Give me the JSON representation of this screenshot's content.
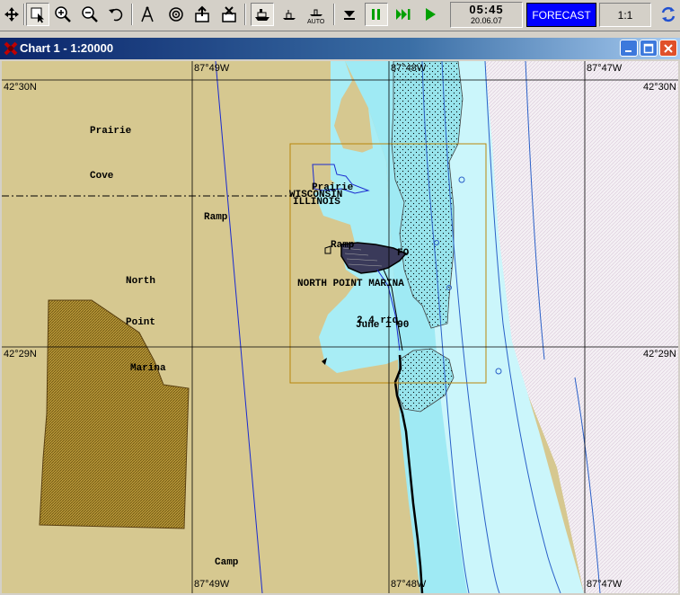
{
  "toolbar": {
    "clock_time": "05:45",
    "clock_date": "20.06.07",
    "forecast_label": "FORECAST",
    "scale_label": "1:1",
    "auto_label": "AUTO"
  },
  "window": {
    "title": "Chart 1 - 1:20000"
  },
  "chart": {
    "lon_labels": {
      "w49": "87°49W",
      "w48": "87°48W",
      "w47": "87°47W"
    },
    "lat_labels": {
      "n30": "42°30N",
      "n29": "42°29N"
    },
    "place_labels": {
      "prairie": "Prairie",
      "cove": "Cove",
      "ramp": "Ramp",
      "north": "North",
      "point": "Point",
      "marina": "Marina",
      "camp": "Camp",
      "prairie_small": "Prairie",
      "wisconsin": "WISCONSIN",
      "illinois": "ILLINOIS",
      "ramp_small": "Ramp",
      "north_point_marina": "NORTH POINT MARINA",
      "buoy_label": "2.4 rtq",
      "date_label": "June 1 90",
      "marina_fo": "FO"
    }
  }
}
